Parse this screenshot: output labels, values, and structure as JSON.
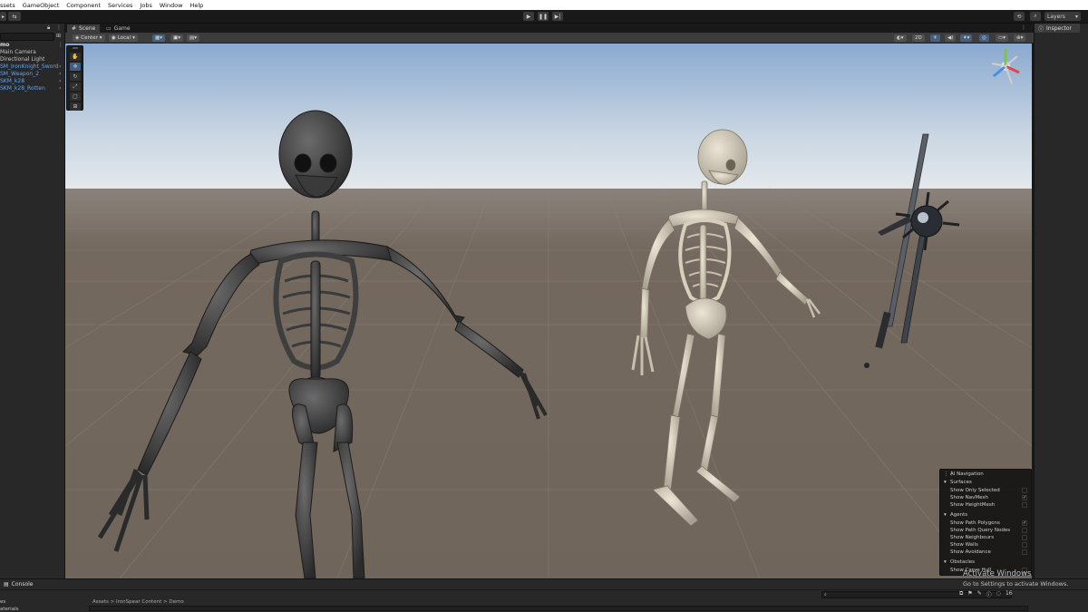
{
  "menubar": {
    "items": [
      "ssets",
      "GameObject",
      "Component",
      "Services",
      "Jobs",
      "Window",
      "Help"
    ]
  },
  "toolbar": {
    "play_icon": "play-icon",
    "pause_icon": "pause-icon",
    "step_icon": "step-icon",
    "layers_label": "Layers",
    "history_icon": "history-icon",
    "search_icon": "search-icon"
  },
  "hierarchy": {
    "root": "mo",
    "items": [
      {
        "label": "Main Camera",
        "prefab": false
      },
      {
        "label": "Directional Light",
        "prefab": false
      },
      {
        "label": "SM_IronKnight_Sword",
        "prefab": true
      },
      {
        "label": "SM_Weapon_2",
        "prefab": true
      },
      {
        "label": "SKM_k28",
        "prefab": true
      },
      {
        "label": "SKM_k28_Rotten",
        "prefab": true
      }
    ]
  },
  "scene": {
    "tabs": [
      "Scene",
      "Game"
    ],
    "pivot_label": "Center",
    "space_label": "Local",
    "mode_2d_label": "2D"
  },
  "inspector": {
    "tab_label": "Inspector"
  },
  "ai_navigation": {
    "title": "AI Navigation",
    "sections": [
      {
        "name": "Surfaces",
        "options": [
          {
            "label": "Show Only Selected",
            "checked": false
          },
          {
            "label": "Show NavMesh",
            "checked": true
          },
          {
            "label": "Show HeightMesh",
            "checked": false
          }
        ]
      },
      {
        "name": "Agents",
        "options": [
          {
            "label": "Show Path Polygons",
            "checked": true
          },
          {
            "label": "Show Path Query Nodes",
            "checked": false
          },
          {
            "label": "Show Neighbours",
            "checked": false
          },
          {
            "label": "Show Walls",
            "checked": false
          },
          {
            "label": "Show Avoidance",
            "checked": false
          }
        ]
      },
      {
        "name": "Obstacles",
        "options": [
          {
            "label": "Show Carve Hull",
            "checked": false
          }
        ]
      }
    ]
  },
  "console": {
    "tab_label": "Console",
    "breadcrumb": "Assets > IronSpear Content > Demo",
    "left_rows": [
      "es",
      "aterials"
    ],
    "count": "16"
  },
  "watermark": {
    "line1": "Activate Windows",
    "line2": "Go to Settings to activate Windows."
  },
  "colors": {
    "sky_top": "#8aa9d0",
    "sky_horizon": "#e4e8ec",
    "ground": "#6f6760",
    "selection_blue": "#3a5f8a",
    "prefab_blue": "#6aa2e8"
  }
}
